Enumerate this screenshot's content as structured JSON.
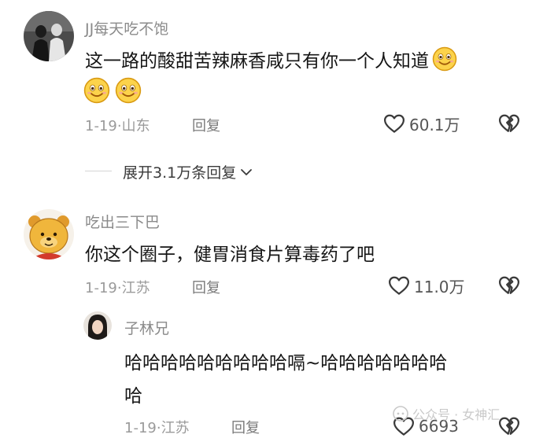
{
  "comments": [
    {
      "username": "JJ每天吃不饱",
      "text": "这一路的酸甜苦辣麻香咸只有你一个人知道",
      "date": "1-19",
      "separator": "·",
      "location": "山东",
      "reply_label": "回复",
      "likes": "60.1万"
    },
    {
      "username": "吃出三下巴",
      "text": "你这个圈子，健胃消食片算毒药了吧",
      "date": "1-19",
      "separator": "·",
      "location": "江苏",
      "reply_label": "回复",
      "likes": "11.0万"
    }
  ],
  "expand_replies": "展开3.1万条回复",
  "reply": {
    "username": "子林兄",
    "text_line1": "哈哈哈哈哈哈哈哈哈嗝~哈哈哈哈哈哈哈",
    "text_line2": "哈",
    "date": "1-19",
    "separator": "·",
    "location": "江苏",
    "reply_label": "回复",
    "likes": "6693"
  },
  "watermark": {
    "text": "公众号 · 女神汇",
    "icon": "wechat-official-account-icon"
  },
  "icons": {
    "like": "heart-outline-icon",
    "dislike": "broken-heart-icon",
    "expand": "chevron-down-icon",
    "emoji": "smiley-emoji-icon"
  },
  "colors": {
    "text": "#161616",
    "secondary": "#8a8a8a",
    "divider": "#e6e6e6"
  }
}
